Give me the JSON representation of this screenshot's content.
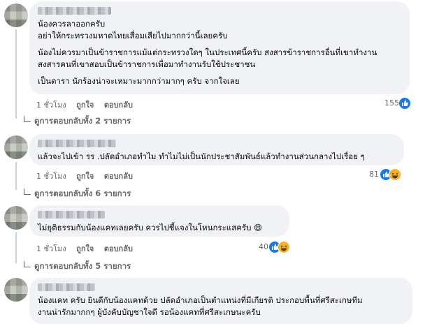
{
  "comments": [
    {
      "lines": [
        "น้องควรลาออกครับ",
        "อย่าให้กระทรวงมหาดไทยเสื่อมเสียไปมากกว่านี้เลยครับ",
        "",
        "น้องไม่ควรมาเป็นข้าราชการแม้แต่กระทรวงใดๆ ในประเทศนี้ครับ สงสารข้าราชการอื่นที่เขาทำงาน",
        "สงสารคนที่เขาสอบเป็นข้าราชการเพื่อมาทำงานรับใช้ประชาชน",
        "",
        "เป็นดารา นักร้องน่าจะเหมาะมากกว่ามากๆ ครับ จากใจเลย"
      ],
      "time": "1 ชั่วโมง",
      "like": "ถูกใจ",
      "reply": "ตอบกลับ",
      "reactions": "155",
      "replies": "ดูการตอบกลับทั้ง 2 รายการ"
    },
    {
      "lines": [
        "แล้วจะไปเข้า รร .ปลัดอำเภอทำไม ทำไมไม่เป็นนักประชาสัมพันธ์แล้วทำงานส่วนกลางไปเรื่อย ๆ"
      ],
      "time": "1 ชั่วโมง",
      "like": "ถูกใจ",
      "reply": "ตอบกลับ",
      "reactions": "81",
      "replies": "ดูการตอบกลับทั้ง 6 รายการ"
    },
    {
      "lines": [
        "ไม่ยุติธรรมกับน้องแคทเลยครับ ควรไปชี้แจงในโหนกระแสครับ 😄"
      ],
      "time": "1 ชั่วโมง",
      "like": "ถูกใจ",
      "reply": "ตอบกลับ",
      "reactions": "40",
      "replies": "ดูการตอบกลับทั้ง 5 รายการ"
    },
    {
      "lines": [
        "น้องแคท ครับ ยินดีกับน้องแคทด้วย ปลัดอำเภอเป็นตำแหน่งที่มีเกียรติ ประกอบพื้นที่ศรีสะเกษทีม",
        "งานน่ารักมากกๆ ผู้บังคับบัญชาใจดี รอน้องแคทที่ศรีสะเกษนะครับ"
      ]
    }
  ],
  "colors": {
    "bubble": "#f0f2f5",
    "meta": "#65676b",
    "like_blue": "#1877f2",
    "haha_yellow": "#f7b125"
  }
}
